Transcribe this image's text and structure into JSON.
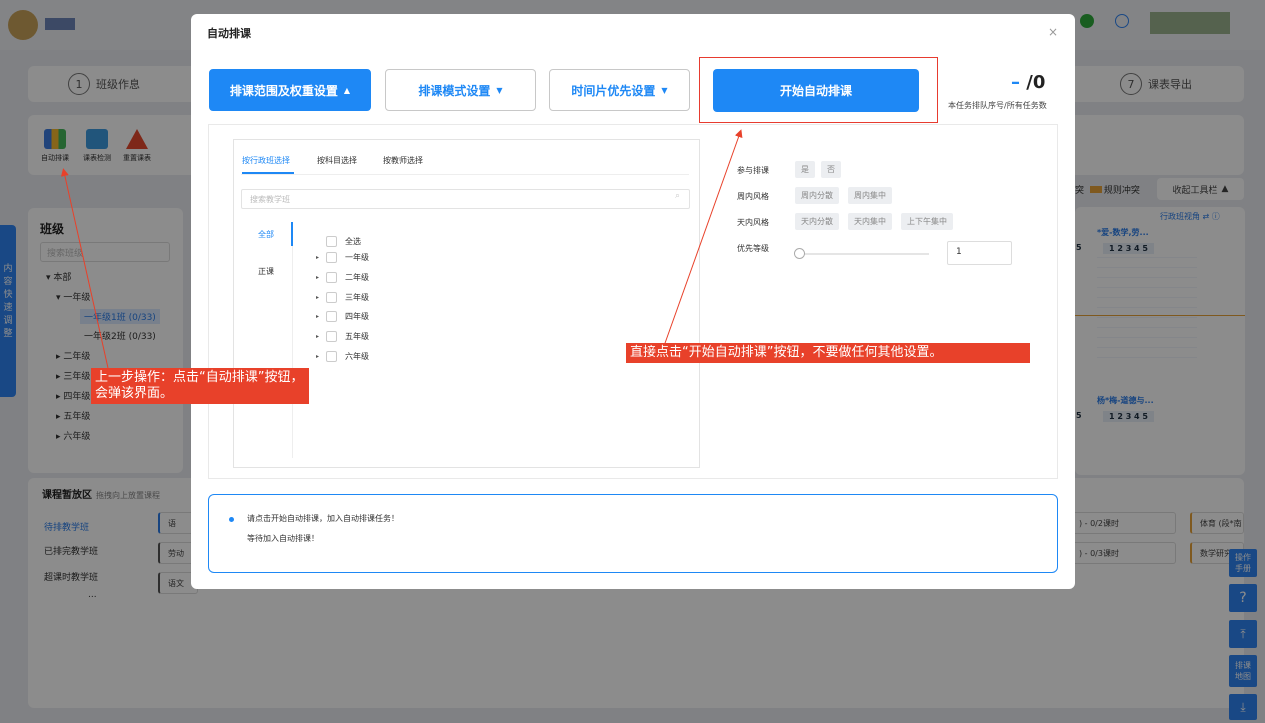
{
  "background": {
    "steps": [
      {
        "num": "1",
        "label": "班级作息"
      },
      {
        "num": "7",
        "label": "课表导出"
      }
    ],
    "toolbar": [
      {
        "label": "自动排课",
        "icon": "auto-schedule-icon"
      },
      {
        "label": "课表检测",
        "icon": "schedule-check-icon"
      },
      {
        "label": "重置课表",
        "icon": "reset-warning-icon"
      }
    ],
    "class_panel": {
      "title": "班级",
      "search_placeholder": "搜索班级",
      "tree": [
        {
          "label": "本部"
        },
        {
          "label": "一年级"
        },
        {
          "label": "一年级1班 (0/33)"
        },
        {
          "label": "一年级2班 (0/33)"
        },
        {
          "label": "二年级"
        },
        {
          "label": "三年级"
        },
        {
          "label": "四年级"
        },
        {
          "label": "五年级"
        },
        {
          "label": "六年级"
        }
      ]
    },
    "side_tab": "内容快速调整",
    "right": {
      "conflict_a": "突",
      "conflict_b": "规则冲突",
      "collapse": "收起工具栏",
      "view_label": "行政班视角",
      "card1_title": "*爱-数学,劳...",
      "card2_title": "杨*梅-道德与...",
      "week_header": "1 2 3 4 5",
      "left_col": "5"
    },
    "bottom": {
      "title": "课程暂放区",
      "hint": "拖拽向上放置课程",
      "nav": [
        "待排教学班",
        "已排完教学班",
        "超课时教学班",
        "..."
      ],
      "chips": [
        "语",
        "劳动",
        "语文",
        ") - 0/2课时",
        ") - 0/3课时",
        "体育 (段*南",
        "数学研究"
      ]
    },
    "float_buttons": [
      "操作手册",
      "排课地图"
    ]
  },
  "modal": {
    "title": "自动排课",
    "close": "×",
    "tabs": [
      {
        "label": "排课范围及权重设置",
        "caret": "▲"
      },
      {
        "label": "排课模式设置",
        "caret": "▼"
      },
      {
        "label": "时间片优先设置",
        "caret": "▼"
      }
    ],
    "start_button": "开始自动排课",
    "counter_value": "/0",
    "counter_dash": "–",
    "counter_label": "本任务排队序号/所有任务数",
    "inner_tabs": [
      "按行政班选择",
      "按科目选择",
      "按教师选择"
    ],
    "search_placeholder": "搜索教学班",
    "vnav": [
      "全部",
      "正课"
    ],
    "grades": [
      "全选",
      "一年级",
      "二年级",
      "三年级",
      "四年级",
      "五年级",
      "六年级"
    ],
    "settings": {
      "participate_label": "参与排课",
      "participate_options": [
        "是",
        "否"
      ],
      "week_style_label": "周内风格",
      "week_style_options": [
        "周内分散",
        "周内集中"
      ],
      "day_style_label": "天内风格",
      "day_style_options": [
        "天内分散",
        "天内集中",
        "上下午集中"
      ],
      "priority_label": "优先等级",
      "priority_value": "1"
    },
    "status_lines": [
      "请点击开始自动排课，加入自动排课任务！",
      "等待加入自动排课！"
    ]
  },
  "annotations": {
    "left": "上一步操作：点击“自动排课”按钮，会弹该界面。",
    "right": "直接点击“开始自动排课”按钮，不要做任何其他设置。"
  },
  "colors": {
    "primary": "#1e88f5",
    "annotation": "#e8412a"
  }
}
